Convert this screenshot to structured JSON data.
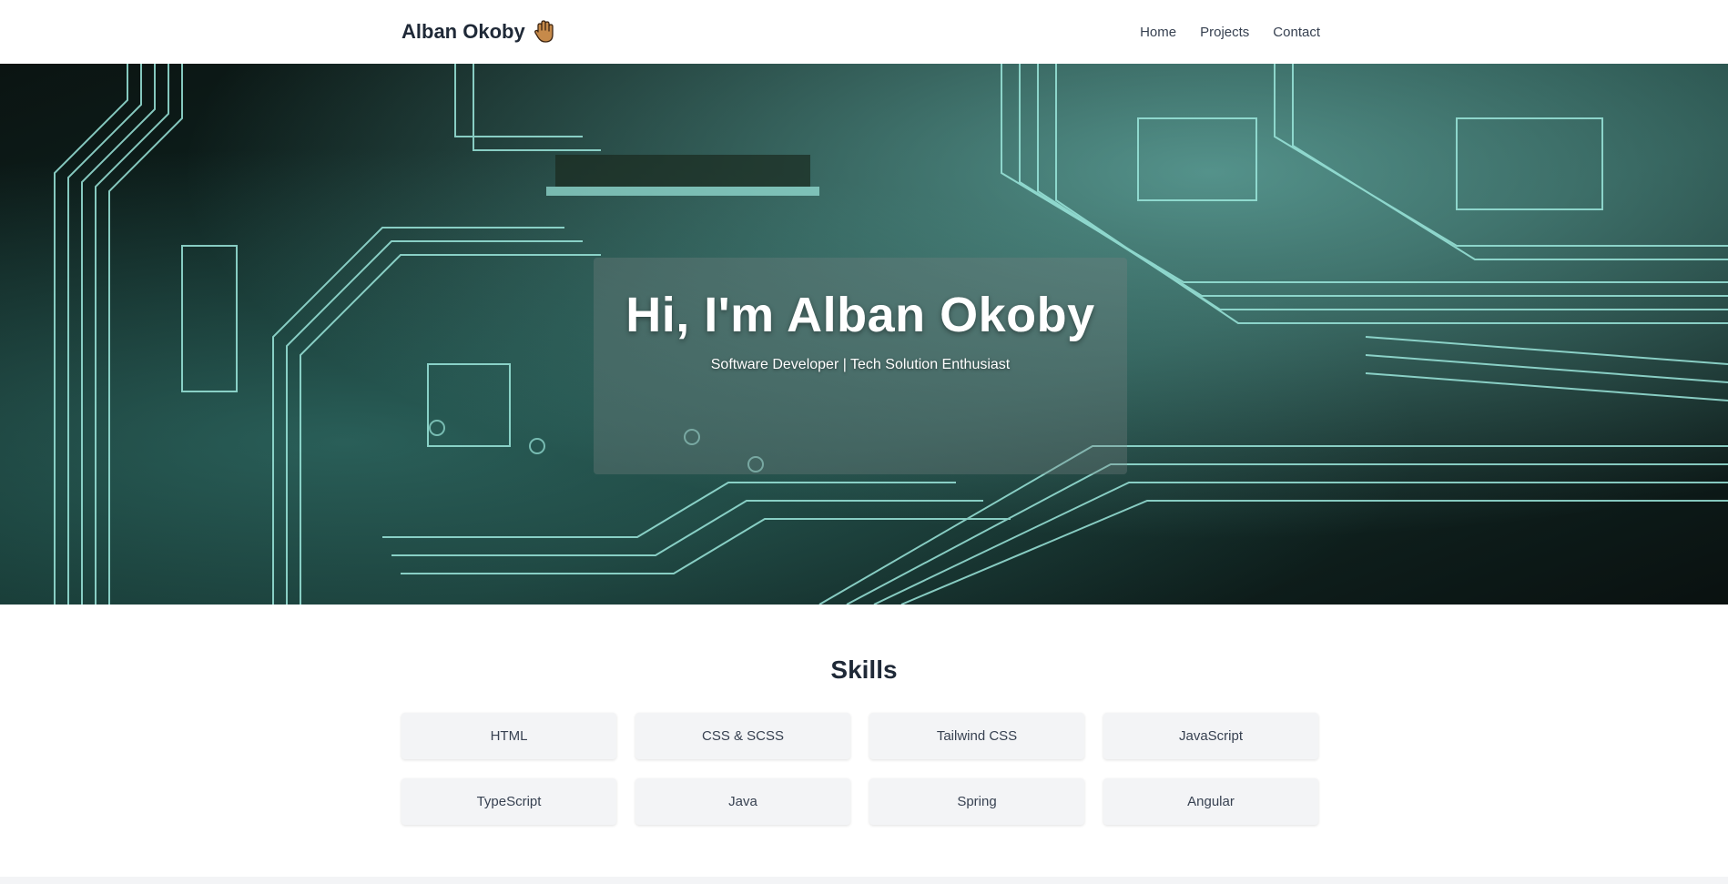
{
  "header": {
    "brand": "Alban Okoby",
    "brand_icon": "waving-hand-icon",
    "nav": [
      {
        "label": "Home"
      },
      {
        "label": "Projects"
      },
      {
        "label": "Contact"
      }
    ]
  },
  "hero": {
    "title": "Hi, I'm Alban Okoby",
    "subtitle": "Software Developer | Tech Solution Enthusiast",
    "background": "circuit-board-image"
  },
  "skills": {
    "title": "Skills",
    "items": [
      {
        "label": "HTML"
      },
      {
        "label": "CSS & SCSS"
      },
      {
        "label": "Tailwind CSS"
      },
      {
        "label": "JavaScript"
      },
      {
        "label": "TypeScript"
      },
      {
        "label": "Java"
      },
      {
        "label": "Spring"
      },
      {
        "label": "Angular"
      }
    ]
  },
  "colors": {
    "text_dark": "#1f2937",
    "skill_bg": "#f3f4f6",
    "hero_accent": "#8fe3d8"
  }
}
